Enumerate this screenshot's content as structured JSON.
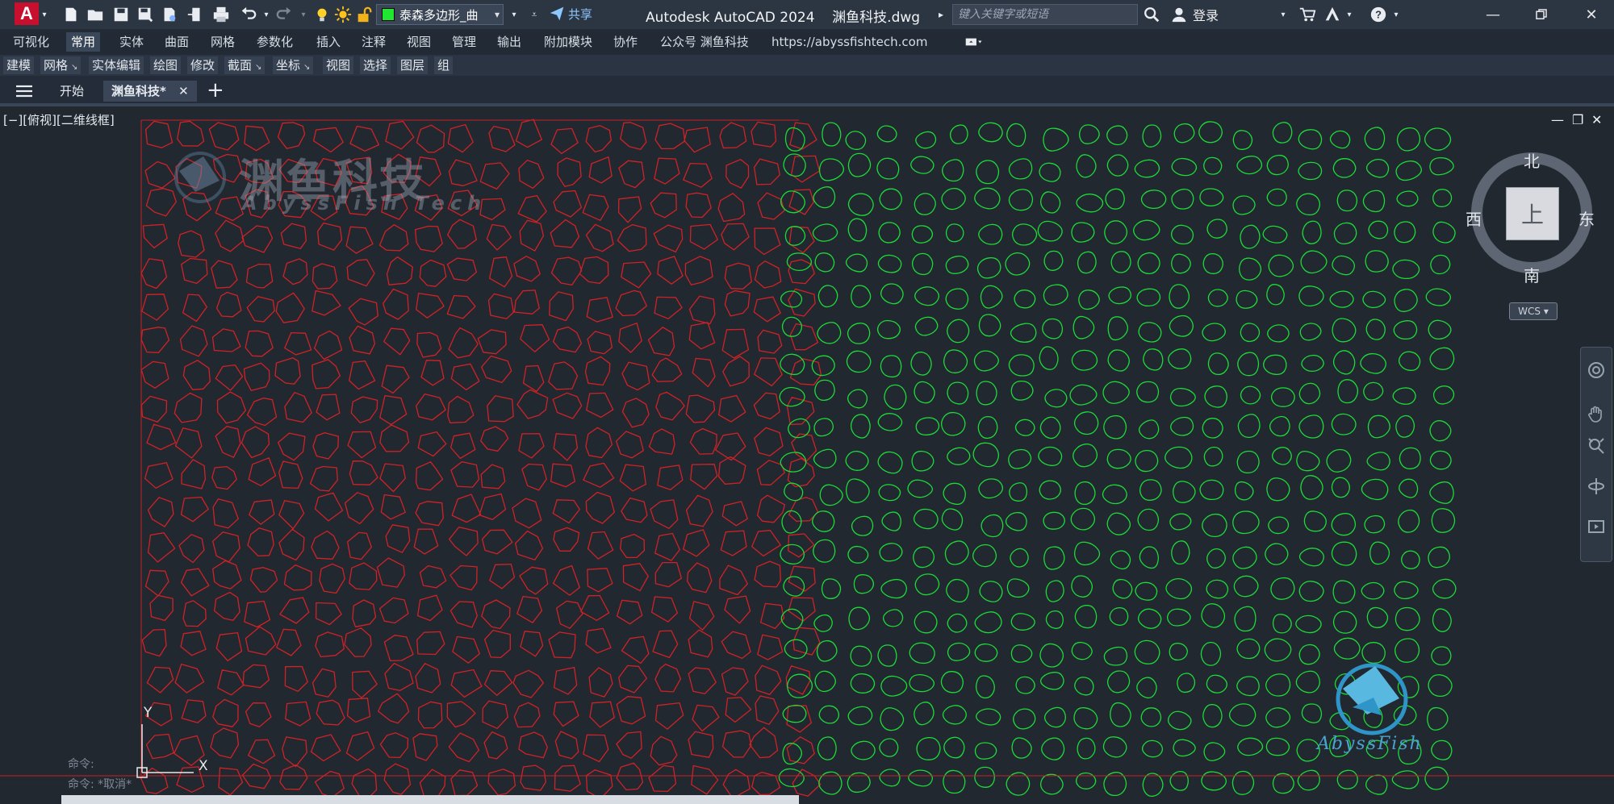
{
  "app": {
    "logo_letter": "A",
    "title": "Autodesk AutoCAD 2024    渊鱼科技.dwg",
    "layer_name": "泰森多边形_曲",
    "layer_color": "#1ee82f",
    "share_label": "共享",
    "search_placeholder": "键入关键字或短语",
    "login_label": "登录"
  },
  "ribbon_tabs": [
    {
      "label": "可视化"
    },
    {
      "label": "常用",
      "active": true
    },
    {
      "label": "实体"
    },
    {
      "label": "曲面"
    },
    {
      "label": "网格"
    },
    {
      "label": "参数化"
    },
    {
      "label": "插入"
    },
    {
      "label": "注释"
    },
    {
      "label": "视图"
    },
    {
      "label": "管理"
    },
    {
      "label": "输出"
    },
    {
      "label": "附加模块"
    },
    {
      "label": "协作"
    },
    {
      "label": "公众号 渊鱼科技"
    },
    {
      "label": "https://abyssfishtech.com"
    }
  ],
  "panels": [
    {
      "label": "建模"
    },
    {
      "label": "网格",
      "dropdown": true
    },
    {
      "label": "实体编辑"
    },
    {
      "label": "绘图"
    },
    {
      "label": "修改"
    },
    {
      "label": "截面",
      "dropdown": true
    },
    {
      "label": "坐标",
      "dropdown": true
    },
    {
      "label": "视图"
    },
    {
      "label": "选择"
    },
    {
      "label": "图层"
    },
    {
      "label": "组"
    }
  ],
  "file_tabs": {
    "start": "开始",
    "active": "渊鱼科技*",
    "close": "✕",
    "new": "+"
  },
  "viewport": {
    "label": "[−][俯视][二维线框]",
    "ucs_y": "Y",
    "ucs_x": "X"
  },
  "viewcube": {
    "top": "上",
    "north": "北",
    "south": "南",
    "east": "东",
    "west": "西",
    "wcs": "WCS"
  },
  "watermark": {
    "title": "渊鱼科技",
    "subtitle": "AbyssFish Tech",
    "logo_text": "AbyssFish"
  },
  "command_history": [
    "命令:",
    "命令: *取消*"
  ],
  "colors": {
    "voronoi": "#d02226",
    "cells": "#1ed838",
    "background": "#212830"
  }
}
